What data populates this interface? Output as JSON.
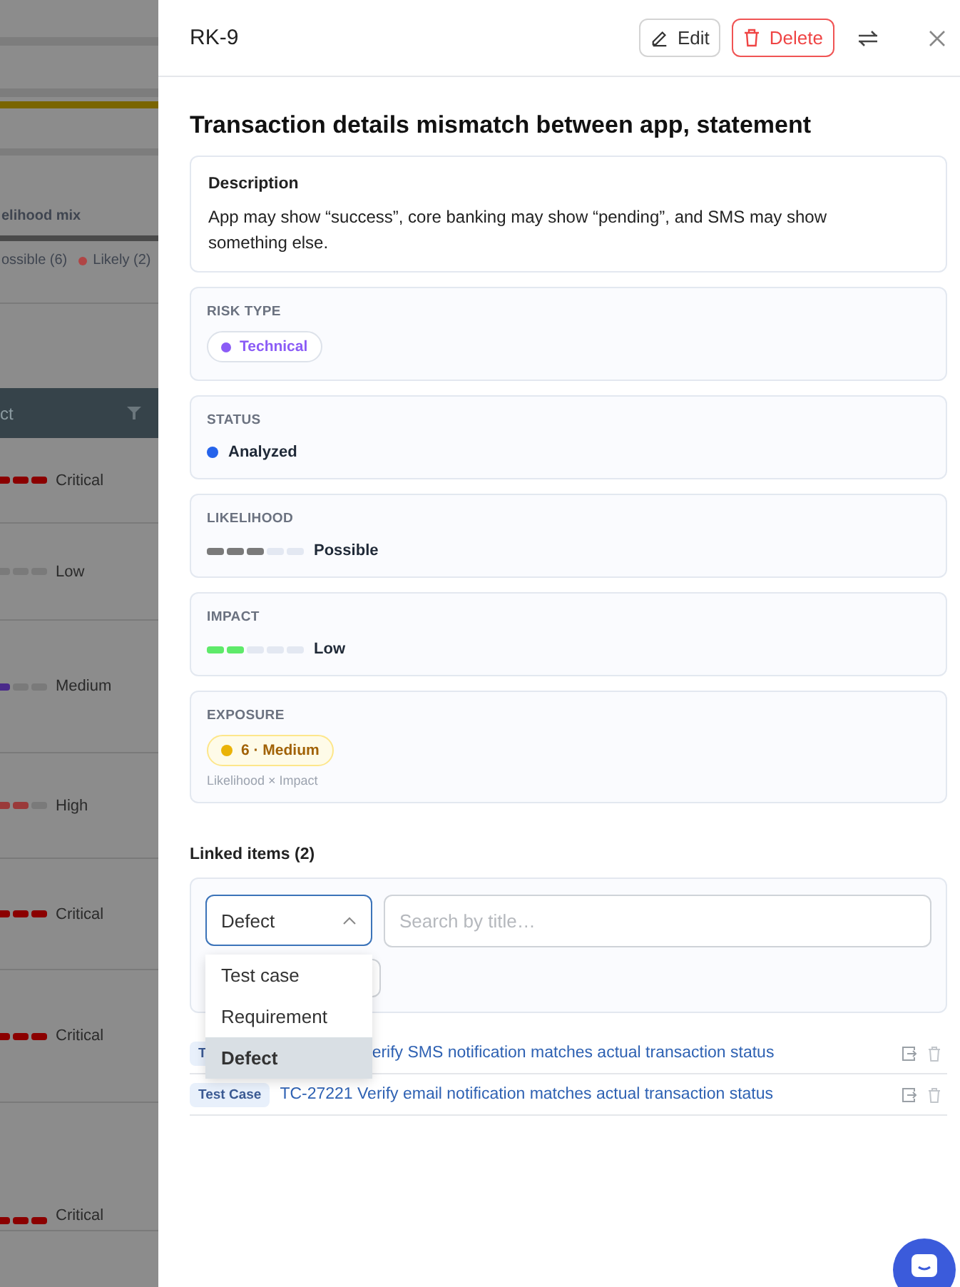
{
  "background_page": {
    "chart_title": "elihood mix",
    "legend": [
      {
        "label": "ossible (6)"
      },
      {
        "label": "Likely (2)",
        "color": "#b04545"
      }
    ],
    "table_header": "ct",
    "rows": [
      {
        "kind": "critical",
        "label": "Critical"
      },
      {
        "kind": "low",
        "label": "Low"
      },
      {
        "kind": "medium",
        "label": "Medium"
      },
      {
        "kind": "high",
        "label": "High"
      },
      {
        "kind": "critical",
        "label": "Critical"
      },
      {
        "kind": "critical",
        "label": "Critical"
      },
      {
        "kind": "critical",
        "label": "Critical"
      }
    ]
  },
  "drawer": {
    "id": "RK-9",
    "edit_label": "Edit",
    "delete_label": "Delete",
    "title": "Transaction details mismatch between app, statement",
    "description": {
      "heading": "Description",
      "text": "App may show “success”, core banking may show “pending”, and SMS may show something else."
    },
    "fields": [
      {
        "kind": "pill",
        "label": "RISK TYPE",
        "value": "Technical",
        "color": "#8b5cf6"
      },
      {
        "kind": "dot",
        "label": "STATUS",
        "value": "Analyzed",
        "color": "#2563eb"
      },
      {
        "kind": "meter",
        "label": "LIKELIHOOD",
        "value": "Possible",
        "level": 0.6,
        "color": "#7a7a7a"
      },
      {
        "kind": "meter",
        "label": "IMPACT",
        "value": "Low",
        "level": 0.4,
        "color": "#5eea6a"
      },
      {
        "kind": "exposure",
        "label": "EXPOSURE",
        "value": "6 · Medium",
        "color": "#eab308",
        "note": "Likelihood × Impact"
      }
    ],
    "linked": {
      "heading": "Linked items (2)",
      "type_select": {
        "value": "Defect",
        "expanded": true,
        "options": [
          {
            "label": "Test case",
            "selected": false
          },
          {
            "label": "Requirement",
            "selected": false
          },
          {
            "label": "Defect",
            "selected": true
          }
        ]
      },
      "search": {
        "placeholder": "Search by title…"
      },
      "items": [
        {
          "tag": "T",
          "title": "erify SMS notification matches actual transaction status"
        },
        {
          "tag": "Test Case",
          "title": "TC-27221 Verify email notification matches actual transaction status"
        }
      ]
    }
  }
}
